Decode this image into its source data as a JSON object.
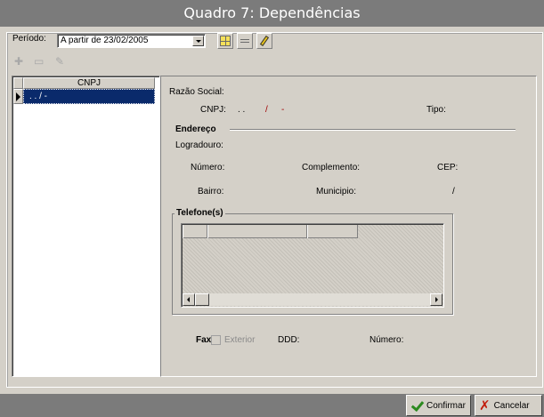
{
  "window": {
    "title": "Quadro 7: Dependências"
  },
  "toolbar": {
    "periodo_label": "Período:",
    "periodo_value": "A partir de 23/02/2005",
    "buttons": [
      "grid-icon",
      "minus-icon",
      "pencil-icon"
    ]
  },
  "list_toolbar": {
    "icons": [
      "plus-icon",
      "minus-icon",
      "pencil-icon"
    ]
  },
  "cnpj_grid": {
    "column_header": "CNPJ",
    "rows": [
      " .  .  /  -"
    ]
  },
  "form": {
    "razao_social_label": "Razão Social:",
    "cnpj_label": "CNPJ:",
    "cnpj_value_dots": ".  .",
    "cnpj_value_slash": "/",
    "cnpj_value_dash": "-",
    "tipo_label": "Tipo:",
    "endereco_title": "Endereço",
    "logradouro_label": "Logradouro:",
    "numero_label": "Número:",
    "complemento_label": "Complemento:",
    "cep_label": "CEP:",
    "bairro_label": "Bairro:",
    "municipio_label": "Municipio:",
    "municipio_value": "/",
    "telefones_title": "Telefone(s)",
    "fax_label": "Fax",
    "exterior_label": "Exterior",
    "ddd_label": "DDD:",
    "fax_numero_label": "Número:"
  },
  "footer": {
    "confirm_label": "Confirmar",
    "cancel_label": "Cancelar"
  }
}
